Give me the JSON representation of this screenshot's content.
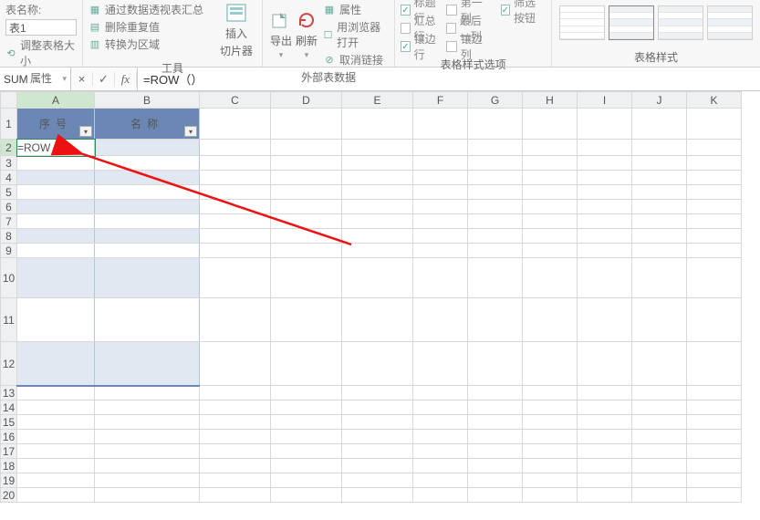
{
  "ribbon": {
    "group_properties": {
      "label": "属性",
      "table_name_label": "表名称:",
      "table_name_value": "表1",
      "resize_label": "调整表格大小"
    },
    "group_tools": {
      "label": "工具",
      "pivot_summary": "通过数据透视表汇总",
      "remove_dupes": "删除重复值",
      "convert_range": "转换为区域",
      "insert_slicer_line1": "插入",
      "insert_slicer_line2": "切片器"
    },
    "group_external": {
      "label": "外部表数据",
      "export": "导出",
      "refresh": "刷新",
      "ext_props": "属性",
      "open_browser": "用浏览器打开",
      "unlink": "取消链接"
    },
    "group_style_options": {
      "label": "表格样式选项",
      "header_row": "标题行",
      "first_col": "第一列",
      "filter_btn": "筛选按钮",
      "total_row": "汇总行",
      "last_col": "最后一列",
      "banded_rows": "镶边行",
      "banded_cols": "镶边列"
    },
    "group_styles": {
      "label": "表格样式"
    }
  },
  "formula_bar": {
    "name_box": "SUM",
    "cancel": "×",
    "confirm": "✓",
    "fx": "fx",
    "formula": "=ROW（）"
  },
  "columns": [
    "A",
    "B",
    "C",
    "D",
    "E",
    "F",
    "G",
    "H",
    "I",
    "J",
    "K"
  ],
  "rows": [
    "1",
    "2",
    "3",
    "4",
    "5",
    "6",
    "7",
    "8",
    "9",
    "10",
    "11",
    "12",
    "13",
    "14",
    "15",
    "16",
    "17",
    "18",
    "19",
    "20"
  ],
  "table_headers": {
    "col_a": "序号",
    "col_b": "名称"
  },
  "editing_cell_text": "=ROW（）",
  "filter_glyph": "▾"
}
